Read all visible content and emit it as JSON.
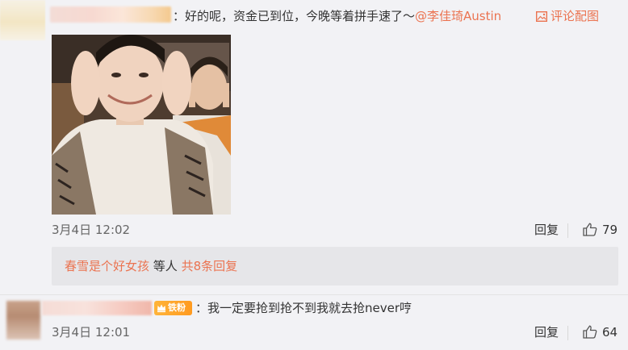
{
  "comment1": {
    "text": "：好的呢，资金已到位，今晚等着拼手速了～",
    "mention": "@李佳琦Austin",
    "pic_link": "评论配图",
    "time": "3月4日 12:02",
    "reply_label": "回复",
    "like_count": "79",
    "subreply": {
      "author": "春雪是个好女孩",
      "text": "等人",
      "more": "共8条回复"
    }
  },
  "comment2": {
    "badge": "铁粉",
    "text": "：我一定要抢到抢不到我就去抢never哼",
    "time": "3月4日 12:01",
    "reply_label": "回复",
    "like_count": "64"
  },
  "icons": {
    "pic": "image-icon",
    "like": "thumbs-up-icon",
    "crown": "crown-icon"
  },
  "colors": {
    "accent": "#eb7350",
    "badge": "#ff9a1f",
    "background": "#f2f2f5",
    "subreply_bg": "#e6e6e9"
  }
}
